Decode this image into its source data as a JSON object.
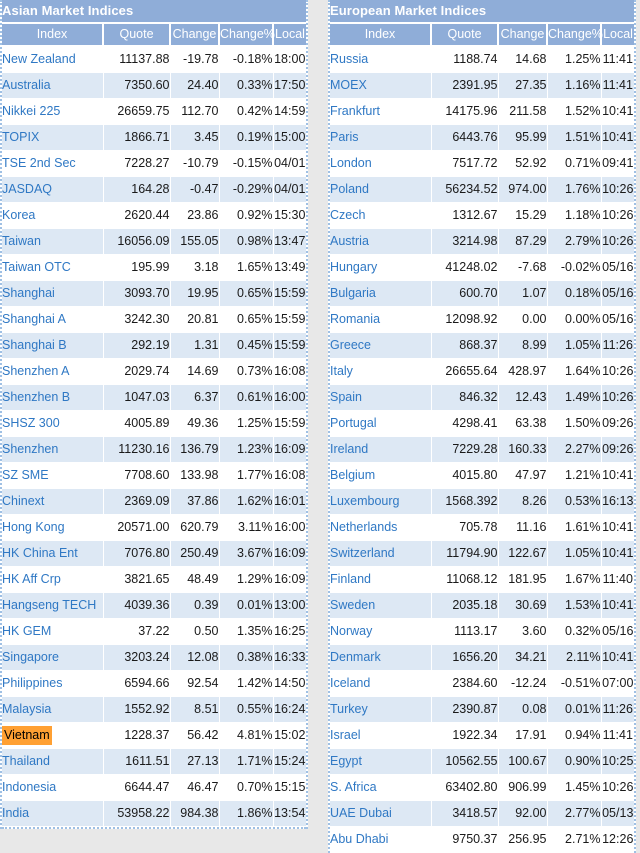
{
  "colors": {
    "header_bg": "#8fadd8",
    "up": "#2f7d32",
    "down": "#ef3b2d",
    "index_link": "#2f78c4",
    "highlight": "#ffa033",
    "row_alt": "#dde8f4"
  },
  "columns": {
    "index": "Index",
    "quote": "Quote",
    "change": "Change",
    "change_pct": "Change%",
    "local": "Local"
  },
  "asian": {
    "title": "Asian Market Indices",
    "rows": [
      {
        "index": "New Zealand",
        "quote": "11137.88",
        "change": "-19.78",
        "pct": "-0.18%",
        "local": "18:00",
        "dir": "down"
      },
      {
        "index": "Australia",
        "quote": "7350.60",
        "change": "24.40",
        "pct": "0.33%",
        "local": "17:50",
        "dir": "up"
      },
      {
        "index": "Nikkei 225",
        "quote": "26659.75",
        "change": "112.70",
        "pct": "0.42%",
        "local": "14:59",
        "dir": "up"
      },
      {
        "index": "TOPIX",
        "quote": "1866.71",
        "change": "3.45",
        "pct": "0.19%",
        "local": "15:00",
        "dir": "up"
      },
      {
        "index": "TSE 2nd Sec",
        "quote": "7228.27",
        "change": "-10.79",
        "pct": "-0.15%",
        "local": "04/01",
        "dir": "down"
      },
      {
        "index": "JASDAQ",
        "quote": "164.28",
        "change": "-0.47",
        "pct": "-0.29%",
        "local": "04/01",
        "dir": "down"
      },
      {
        "index": "Korea",
        "quote": "2620.44",
        "change": "23.86",
        "pct": "0.92%",
        "local": "15:30",
        "dir": "up"
      },
      {
        "index": "Taiwan",
        "quote": "16056.09",
        "change": "155.05",
        "pct": "0.98%",
        "local": "13:47",
        "dir": "up"
      },
      {
        "index": "Taiwan OTC",
        "quote": "195.99",
        "change": "3.18",
        "pct": "1.65%",
        "local": "13:49",
        "dir": "up"
      },
      {
        "index": "Shanghai",
        "quote": "3093.70",
        "change": "19.95",
        "pct": "0.65%",
        "local": "15:59",
        "dir": "up"
      },
      {
        "index": "Shanghai A",
        "quote": "3242.30",
        "change": "20.81",
        "pct": "0.65%",
        "local": "15:59",
        "dir": "up"
      },
      {
        "index": "Shanghai B",
        "quote": "292.19",
        "change": "1.31",
        "pct": "0.45%",
        "local": "15:59",
        "dir": "up"
      },
      {
        "index": "Shenzhen A",
        "quote": "2029.74",
        "change": "14.69",
        "pct": "0.73%",
        "local": "16:08",
        "dir": "up"
      },
      {
        "index": "Shenzhen B",
        "quote": "1047.03",
        "change": "6.37",
        "pct": "0.61%",
        "local": "16:00",
        "dir": "up"
      },
      {
        "index": "SHSZ 300",
        "quote": "4005.89",
        "change": "49.36",
        "pct": "1.25%",
        "local": "15:59",
        "dir": "up"
      },
      {
        "index": "Shenzhen",
        "quote": "11230.16",
        "change": "136.79",
        "pct": "1.23%",
        "local": "16:09",
        "dir": "up"
      },
      {
        "index": "SZ SME",
        "quote": "7708.60",
        "change": "133.98",
        "pct": "1.77%",
        "local": "16:08",
        "dir": "up"
      },
      {
        "index": "Chinext",
        "quote": "2369.09",
        "change": "37.86",
        "pct": "1.62%",
        "local": "16:01",
        "dir": "up"
      },
      {
        "index": "Hong Kong",
        "quote": "20571.00",
        "change": "620.79",
        "pct": "3.11%",
        "local": "16:00",
        "dir": "up"
      },
      {
        "index": "HK China Ent",
        "quote": "7076.80",
        "change": "250.49",
        "pct": "3.67%",
        "local": "16:09",
        "dir": "up"
      },
      {
        "index": "HK Aff Crp",
        "quote": "3821.65",
        "change": "48.49",
        "pct": "1.29%",
        "local": "16:09",
        "dir": "up"
      },
      {
        "index": "Hangseng TECH",
        "quote": "4039.36",
        "change": "0.39",
        "pct": "0.01%",
        "local": "13:00",
        "dir": "up"
      },
      {
        "index": "HK GEM",
        "quote": "37.22",
        "change": "0.50",
        "pct": "1.35%",
        "local": "16:25",
        "dir": "up"
      },
      {
        "index": "Singapore",
        "quote": "3203.24",
        "change": "12.08",
        "pct": "0.38%",
        "local": "16:33",
        "dir": "up"
      },
      {
        "index": "Philippines",
        "quote": "6594.66",
        "change": "92.54",
        "pct": "1.42%",
        "local": "14:50",
        "dir": "up"
      },
      {
        "index": "Malaysia",
        "quote": "1552.92",
        "change": "8.51",
        "pct": "0.55%",
        "local": "16:24",
        "dir": "up"
      },
      {
        "index": "Vietnam",
        "quote": "1228.37",
        "change": "56.42",
        "pct": "4.81%",
        "local": "15:02",
        "dir": "up",
        "highlight": true
      },
      {
        "index": "Thailand",
        "quote": "1611.51",
        "change": "27.13",
        "pct": "1.71%",
        "local": "15:24",
        "dir": "up"
      },
      {
        "index": "Indonesia",
        "quote": "6644.47",
        "change": "46.47",
        "pct": "0.70%",
        "local": "15:15",
        "dir": "up"
      },
      {
        "index": "India",
        "quote": "53958.22",
        "change": "984.38",
        "pct": "1.86%",
        "local": "13:54",
        "dir": "up"
      }
    ]
  },
  "european": {
    "title": "European Market Indices",
    "rows": [
      {
        "index": "Russia",
        "quote": "1188.74",
        "change": "14.68",
        "pct": "1.25%",
        "local": "11:41",
        "dir": "up"
      },
      {
        "index": "MOEX",
        "quote": "2391.95",
        "change": "27.35",
        "pct": "1.16%",
        "local": "11:41",
        "dir": "up"
      },
      {
        "index": "Frankfurt",
        "quote": "14175.96",
        "change": "211.58",
        "pct": "1.52%",
        "local": "10:41",
        "dir": "up"
      },
      {
        "index": "Paris",
        "quote": "6443.76",
        "change": "95.99",
        "pct": "1.51%",
        "local": "10:41",
        "dir": "up"
      },
      {
        "index": "London",
        "quote": "7517.72",
        "change": "52.92",
        "pct": "0.71%",
        "local": "09:41",
        "dir": "up"
      },
      {
        "index": "Poland",
        "quote": "56234.52",
        "change": "974.00",
        "pct": "1.76%",
        "local": "10:26",
        "dir": "up"
      },
      {
        "index": "Czech",
        "quote": "1312.67",
        "change": "15.29",
        "pct": "1.18%",
        "local": "10:26",
        "dir": "up"
      },
      {
        "index": "Austria",
        "quote": "3214.98",
        "change": "87.29",
        "pct": "2.79%",
        "local": "10:26",
        "dir": "up"
      },
      {
        "index": "Hungary",
        "quote": "41248.02",
        "change": "-7.68",
        "pct": "-0.02%",
        "local": "05/16",
        "dir": "down"
      },
      {
        "index": "Bulgaria",
        "quote": "600.70",
        "change": "1.07",
        "pct": "0.18%",
        "local": "05/16",
        "dir": "up"
      },
      {
        "index": "Romania",
        "quote": "12098.92",
        "change": "0.00",
        "pct": "0.00%",
        "local": "05/16",
        "dir": "flat"
      },
      {
        "index": "Greece",
        "quote": "868.37",
        "change": "8.99",
        "pct": "1.05%",
        "local": "11:26",
        "dir": "up"
      },
      {
        "index": "Italy",
        "quote": "26655.64",
        "change": "428.97",
        "pct": "1.64%",
        "local": "10:26",
        "dir": "up"
      },
      {
        "index": "Spain",
        "quote": "846.32",
        "change": "12.43",
        "pct": "1.49%",
        "local": "10:26",
        "dir": "up"
      },
      {
        "index": "Portugal",
        "quote": "4298.41",
        "change": "63.38",
        "pct": "1.50%",
        "local": "09:26",
        "dir": "up"
      },
      {
        "index": "Ireland",
        "quote": "7229.28",
        "change": "160.33",
        "pct": "2.27%",
        "local": "09:26",
        "dir": "up"
      },
      {
        "index": "Belgium",
        "quote": "4015.80",
        "change": "47.97",
        "pct": "1.21%",
        "local": "10:41",
        "dir": "up"
      },
      {
        "index": "Luxembourg",
        "quote": "1568.392",
        "change": "8.26",
        "pct": "0.53%",
        "local": "16:13",
        "dir": "up"
      },
      {
        "index": "Netherlands",
        "quote": "705.78",
        "change": "11.16",
        "pct": "1.61%",
        "local": "10:41",
        "dir": "up"
      },
      {
        "index": "Switzerland",
        "quote": "11794.90",
        "change": "122.67",
        "pct": "1.05%",
        "local": "10:41",
        "dir": "up"
      },
      {
        "index": "Finland",
        "quote": "11068.12",
        "change": "181.95",
        "pct": "1.67%",
        "local": "11:40",
        "dir": "up"
      },
      {
        "index": "Sweden",
        "quote": "2035.18",
        "change": "30.69",
        "pct": "1.53%",
        "local": "10:41",
        "dir": "up"
      },
      {
        "index": "Norway",
        "quote": "1113.17",
        "change": "3.60",
        "pct": "0.32%",
        "local": "05/16",
        "dir": "up"
      },
      {
        "index": "Denmark",
        "quote": "1656.20",
        "change": "34.21",
        "pct": "2.11%",
        "local": "10:41",
        "dir": "up"
      },
      {
        "index": "Iceland",
        "quote": "2384.60",
        "change": "-12.24",
        "pct": "-0.51%",
        "local": "07:00",
        "dir": "down"
      },
      {
        "index": "Turkey",
        "quote": "2390.87",
        "change": "0.08",
        "pct": "0.01%",
        "local": "11:26",
        "dir": "up"
      },
      {
        "index": "Israel",
        "quote": "1922.34",
        "change": "17.91",
        "pct": "0.94%",
        "local": "11:41",
        "dir": "up"
      },
      {
        "index": "Egypt",
        "quote": "10562.55",
        "change": "100.67",
        "pct": "0.90%",
        "local": "10:25",
        "dir": "up"
      },
      {
        "index": "S. Africa",
        "quote": "63402.80",
        "change": "906.99",
        "pct": "1.45%",
        "local": "10:26",
        "dir": "up"
      },
      {
        "index": "UAE Dubai",
        "quote": "3418.57",
        "change": "92.00",
        "pct": "2.77%",
        "local": "05/13",
        "dir": "up"
      },
      {
        "index": "Abu Dhabi",
        "quote": "9750.37",
        "change": "256.95",
        "pct": "2.71%",
        "local": "12:26",
        "dir": "up"
      }
    ]
  }
}
